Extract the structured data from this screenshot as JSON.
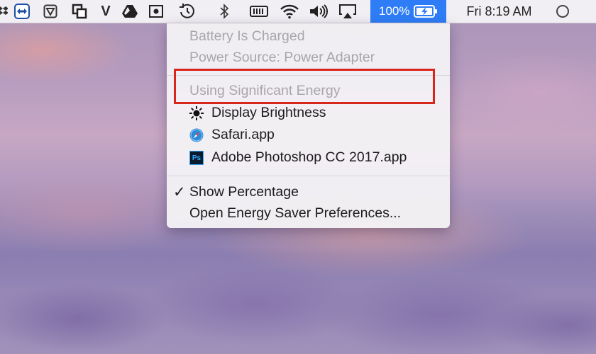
{
  "menubar": {
    "icons": [
      "dropbox-icon",
      "teamviewer-icon",
      "vpn-icon",
      "duet-icon",
      "vysor-icon",
      "google-drive-icon",
      "screen-record-icon",
      "time-machine-icon",
      "bluetooth-icon",
      "ram-icon",
      "wifi-icon",
      "volume-icon",
      "airplay-icon"
    ],
    "battery_percent": "100%",
    "clock": "Fri 8:19 AM"
  },
  "battery_menu": {
    "status_line": "Battery Is Charged",
    "power_source": "Power Source: Power Adapter",
    "energy_header": "Using Significant Energy",
    "energy_apps": [
      {
        "label": "Display Brightness",
        "icon": "brightness-icon"
      },
      {
        "label": "Safari.app",
        "icon": "safari-icon"
      },
      {
        "label": "Adobe Photoshop CC 2017.app",
        "icon": "photoshop-icon",
        "icon_text": "Ps"
      }
    ],
    "checkmark": "✓",
    "show_percentage": "Show Percentage",
    "open_prefs": "Open Energy Saver Preferences..."
  },
  "colors": {
    "menubar_highlight": "#2e7df6",
    "annotation_border": "#d9261c"
  }
}
